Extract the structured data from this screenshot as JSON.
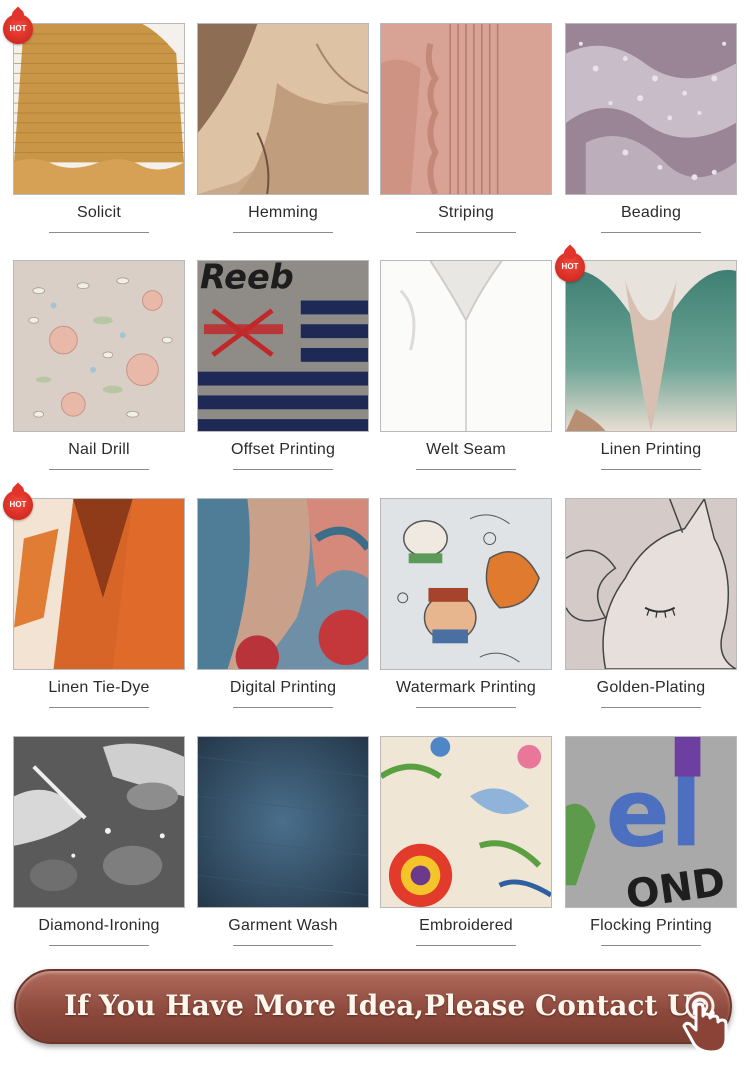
{
  "items": [
    {
      "label": "Solicit",
      "hot": true,
      "art": "smock"
    },
    {
      "label": "Hemming",
      "hot": false,
      "art": "hem"
    },
    {
      "label": "Striping",
      "hot": false,
      "art": "pleat"
    },
    {
      "label": "Beading",
      "hot": false,
      "art": "bead"
    },
    {
      "label": "Nail Drill",
      "hot": false,
      "art": "floral"
    },
    {
      "label": "Offset Printing",
      "hot": false,
      "art": "offset"
    },
    {
      "label": "Welt Seam",
      "hot": false,
      "art": "welt"
    },
    {
      "label": "Linen Printing",
      "hot": true,
      "art": "linen"
    },
    {
      "label": "Linen Tie-Dye",
      "hot": true,
      "art": "tiedye"
    },
    {
      "label": "Digital Printing",
      "hot": false,
      "art": "digital"
    },
    {
      "label": "Watermark Printing",
      "hot": false,
      "art": "watermark"
    },
    {
      "label": "Golden-Plating",
      "hot": false,
      "art": "unicorn"
    },
    {
      "label": "Diamond-Ironing",
      "hot": false,
      "art": "diamond"
    },
    {
      "label": "Garment Wash",
      "hot": false,
      "art": "denim"
    },
    {
      "label": "Embroidered",
      "hot": false,
      "art": "embroid"
    },
    {
      "label": "Flocking Printing",
      "hot": false,
      "art": "flock"
    }
  ],
  "hot_badge": "HOT",
  "offset_print_text": "Reeb",
  "flock_letters": "el",
  "flock_bottom": "OND",
  "contact_banner": {
    "text": "If You Have More Idea,Please Contact Us.",
    "icon": "pointing-hand-icon"
  }
}
